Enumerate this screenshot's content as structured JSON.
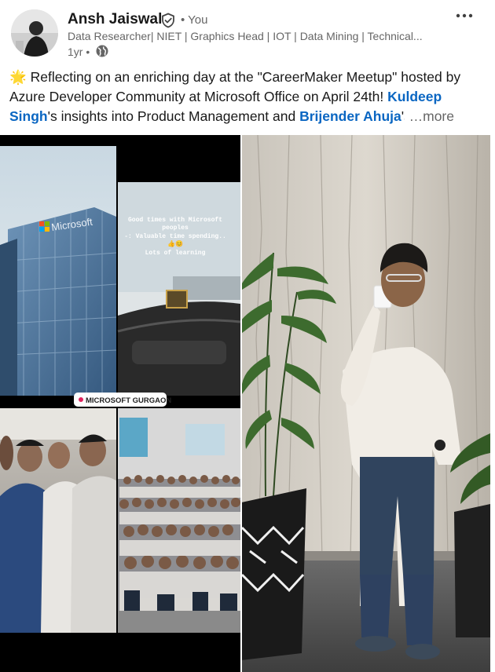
{
  "author": {
    "name": "Ansh Jaiswal",
    "you_label": "• You",
    "headline": "Data Researcher| NIET | Graphics Head | IOT | Data Mining | Technical...",
    "time": "1yr •"
  },
  "post": {
    "emoji": "🌟",
    "text_part1": " Reflecting on an enriching day at the \"CareerMaker Meetup\" hosted by Azure Developer Community at Microsoft Office on April 24th! ",
    "mention1": "Kuldeep Singh",
    "text_part2": "'s insights into Product Management and ",
    "mention2": "Brijender Ahuja",
    "text_part3": "'s",
    "see_more": "…more"
  },
  "collage": {
    "building_sign": "Microsoft",
    "caption_line1": "Good times with Microsoft",
    "caption_line2": "peoples",
    "caption_line3": "-: Valuable time spending..",
    "caption_emoji": "👍😊",
    "caption_line4": "Lots of learning",
    "location_tag": "MICROSOFT GURGAON"
  },
  "icons": {
    "verified": "shield-check-icon",
    "visibility": "globe-icon",
    "menu": "more-horizontal-icon"
  },
  "colors": {
    "link": "#0a66c2",
    "text_primary": "#191919",
    "text_secondary": "#666666"
  }
}
